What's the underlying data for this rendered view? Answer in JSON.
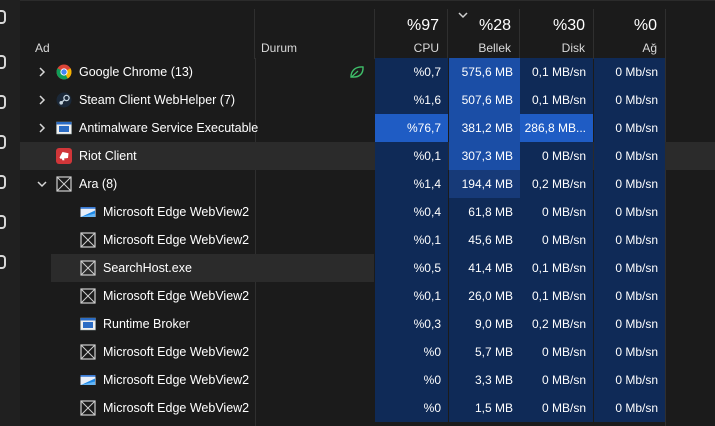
{
  "columns": {
    "name": "Ad",
    "status": "Durum",
    "cpu": {
      "pct": "%97",
      "label": "CPU"
    },
    "memory": {
      "pct": "%28",
      "label": "Bellek"
    },
    "disk": {
      "pct": "%30",
      "label": "Disk"
    },
    "network": {
      "pct": "%0",
      "label": "Ağ"
    }
  },
  "colors": {
    "heat_low": "#0f2a57",
    "heat_mid": "#173a78",
    "heat_high": "#1b4ea6",
    "heat_max": "#1f5cc4"
  },
  "rows": [
    {
      "name": "Google Chrome (13)",
      "icon": "chrome-icon",
      "expand": "collapsed",
      "indent": 0,
      "status_icon": "efficiency-leaf-icon",
      "cpu": "%0,7",
      "memory": "575,6 MB",
      "disk": "0,1 MB/sn",
      "network": "0 Mb/sn"
    },
    {
      "name": "Steam Client WebHelper (7)",
      "icon": "steam-icon",
      "expand": "collapsed",
      "indent": 0,
      "cpu": "%1,6",
      "memory": "507,6 MB",
      "disk": "0,1 MB/sn",
      "network": "0 Mb/sn"
    },
    {
      "name": "Antimalware Service Executable",
      "icon": "antimalware-icon",
      "expand": "collapsed",
      "indent": 0,
      "cpu": "%76,7",
      "memory": "381,2 MB",
      "disk": "286,8 MB...",
      "network": "0 Mb/sn"
    },
    {
      "name": "Riot Client",
      "icon": "riot-icon",
      "expand": "none",
      "indent": 0,
      "cpu": "%0,1",
      "memory": "307,3 MB",
      "disk": "0 MB/sn",
      "network": "0 Mb/sn"
    },
    {
      "name": "Ara (8)",
      "icon": "generic-app-icon",
      "expand": "expanded",
      "indent": 0,
      "cpu": "%1,4",
      "memory": "194,4 MB",
      "disk": "0,2 MB/sn",
      "network": "0 Mb/sn"
    },
    {
      "name": "Microsoft Edge WebView2",
      "icon": "webview-icon",
      "expand": "none",
      "indent": 1,
      "cpu": "%0,4",
      "memory": "61,8 MB",
      "disk": "0 MB/sn",
      "network": "0 Mb/sn"
    },
    {
      "name": "Microsoft Edge WebView2",
      "icon": "generic-app-icon",
      "expand": "none",
      "indent": 1,
      "cpu": "%0,1",
      "memory": "45,6 MB",
      "disk": "0 MB/sn",
      "network": "0 Mb/sn"
    },
    {
      "name": "SearchHost.exe",
      "icon": "generic-app-icon",
      "expand": "none",
      "indent": 1,
      "cpu": "%0,5",
      "memory": "41,4 MB",
      "disk": "0,1 MB/sn",
      "network": "0 Mb/sn"
    },
    {
      "name": "Microsoft Edge WebView2",
      "icon": "generic-app-icon",
      "expand": "none",
      "indent": 1,
      "cpu": "%0,1",
      "memory": "26,0 MB",
      "disk": "0,1 MB/sn",
      "network": "0 Mb/sn"
    },
    {
      "name": "Runtime Broker",
      "icon": "runtime-broker-icon",
      "expand": "none",
      "indent": 1,
      "cpu": "%0,3",
      "memory": "9,0 MB",
      "disk": "0,2 MB/sn",
      "network": "0 Mb/sn"
    },
    {
      "name": "Microsoft Edge WebView2",
      "icon": "generic-app-icon",
      "expand": "none",
      "indent": 1,
      "cpu": "%0",
      "memory": "5,7 MB",
      "disk": "0 MB/sn",
      "network": "0 Mb/sn"
    },
    {
      "name": "Microsoft Edge WebView2",
      "icon": "webview-icon",
      "expand": "none",
      "indent": 1,
      "cpu": "%0",
      "memory": "3,3 MB",
      "disk": "0 MB/sn",
      "network": "0 Mb/sn"
    },
    {
      "name": "Microsoft Edge WebView2",
      "icon": "generic-app-icon",
      "expand": "none",
      "indent": 1,
      "cpu": "%0",
      "memory": "1,5 MB",
      "disk": "0 MB/sn",
      "network": "0 Mb/sn"
    }
  ]
}
